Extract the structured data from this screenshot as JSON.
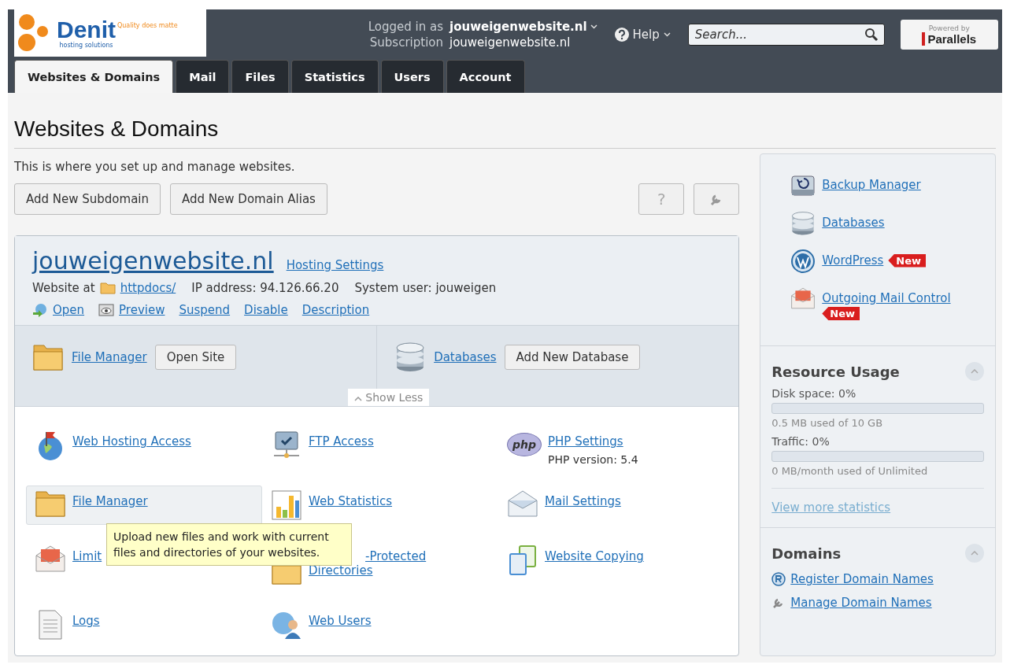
{
  "logo": {
    "name": "Denit",
    "tagline": "Quality does matte",
    "subtitle": "hosting solutions"
  },
  "account": {
    "logged_label": "Logged in as",
    "logged_value": "jouweigenwebsite.nl",
    "sub_label": "Subscription",
    "sub_value": "jouweigenwebsite.nl"
  },
  "help": "Help",
  "search": {
    "placeholder": "Search..."
  },
  "powered": {
    "small": "Powered by",
    "brand": "Parallels"
  },
  "tabs": [
    {
      "label": "Websites & Domains",
      "selected": true
    },
    {
      "label": "Mail",
      "selected": false
    },
    {
      "label": "Files",
      "selected": false
    },
    {
      "label": "Statistics",
      "selected": false
    },
    {
      "label": "Users",
      "selected": false
    },
    {
      "label": "Account",
      "selected": false
    }
  ],
  "page_title": "Websites & Domains",
  "intro": "This is where you set up and manage websites.",
  "actions": [
    "Add New Subdomain",
    "Add New Domain Alias"
  ],
  "tool_buttons": [
    "?"
  ],
  "domain": {
    "name": "jouweigenwebsite.nl",
    "settings_link": "Hosting Settings",
    "website_at": "Website at",
    "path": "httpdocs/",
    "ip": "IP address: 94.126.66.20",
    "user": "System user: jouweigen",
    "links": [
      "Open",
      "Preview",
      "Suspend",
      "Disable",
      "Description"
    ],
    "quick": [
      {
        "link": "File Manager",
        "button": "Open Site"
      },
      {
        "link": "Databases",
        "button": "Add New Database"
      }
    ],
    "toggle": "Show Less"
  },
  "tools": [
    {
      "label": "Web Hosting Access",
      "kind": "link",
      "highlighted": false
    },
    {
      "label": "FTP Access",
      "kind": "link",
      "highlighted": false
    },
    {
      "label": "PHP Settings",
      "kind": "link",
      "icon_text": "php",
      "note": "PHP version: 5.4",
      "highlighted": false
    },
    {
      "label": "File Manager",
      "kind": "link",
      "highlighted": true
    },
    {
      "label": "Web Statistics",
      "kind": "link",
      "highlighted": false
    },
    {
      "label": "Mail Settings",
      "kind": "link",
      "highlighted": false
    },
    {
      "label": "Limit",
      "kind": "link",
      "highlighted": false
    },
    {
      "label": "-Protected Directories",
      "kind": "covered",
      "highlighted": false
    },
    {
      "label": "Website Copying",
      "kind": "link",
      "highlighted": false
    },
    {
      "label": "Logs",
      "kind": "link",
      "highlighted": false
    },
    {
      "label": "Web Users",
      "kind": "link",
      "highlighted": false
    }
  ],
  "tooltip": "Upload new files and work with current files and directories of your websites.",
  "sidebar": {
    "links": [
      {
        "label": "Backup Manager"
      },
      {
        "label": "Databases"
      },
      {
        "label": "WordPress",
        "badge": "New"
      },
      {
        "label": "Outgoing Mail Control",
        "badge": "New"
      }
    ],
    "resource": {
      "title": "Resource Usage",
      "meters": [
        {
          "label": "Disk space: 0%",
          "level": 0,
          "note": "0.5 MB used of 10 GB"
        },
        {
          "label": "Traffic: 0%",
          "level": 0,
          "note": "0 MB/month used of Unlimited"
        }
      ],
      "more": "View more statistics"
    },
    "domains": {
      "title": "Domains",
      "links": [
        "Register Domain Names",
        "Manage Domain Names"
      ]
    }
  }
}
